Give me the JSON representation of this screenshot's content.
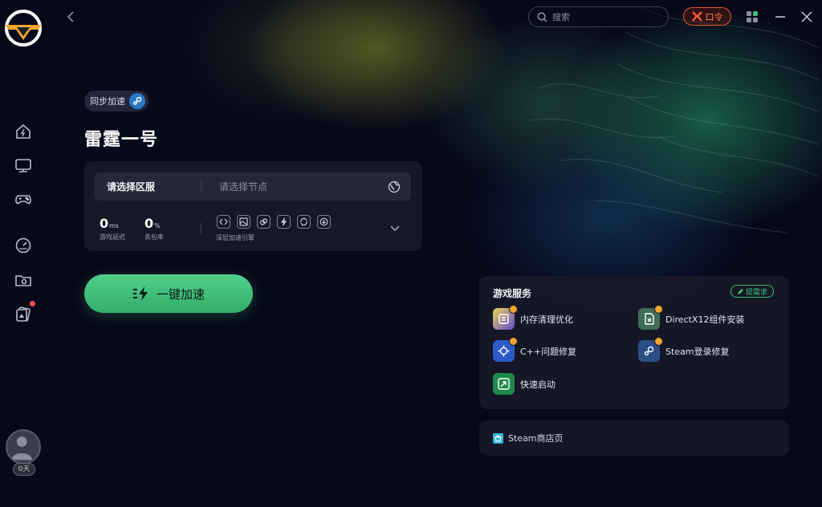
{
  "app": {
    "search_placeholder": "搜索",
    "kouling_label": "口令"
  },
  "sidebar": {
    "items": [
      {
        "name": "home",
        "icon": "home-icon"
      },
      {
        "name": "monitor",
        "icon": "monitor-icon"
      },
      {
        "name": "games",
        "icon": "gamepad-icon"
      },
      {
        "name": "speedometer",
        "icon": "speedometer-icon"
      },
      {
        "name": "folder",
        "icon": "folder-icon"
      },
      {
        "name": "cards",
        "icon": "cards-icon"
      }
    ],
    "user_badge": "0天"
  },
  "main": {
    "sync_label": "同步加速",
    "game_title": "雷霆一号",
    "server": {
      "region_label": "请选择区服",
      "node_placeholder": "请选择节点"
    },
    "stats": {
      "latency_value": "0",
      "latency_unit": "ms",
      "latency_label": "游戏延迟",
      "loss_value": "0",
      "loss_unit": "%",
      "loss_label": "丢包率"
    },
    "engine_label": "深层加速引擎",
    "accelerate_label": "一键加速"
  },
  "services": {
    "title": "游戏服务",
    "request_label": "提需求",
    "items": [
      {
        "label": "内存清理优化",
        "color": "#5b4ac9"
      },
      {
        "label": "DirectX12组件安装",
        "color": "#2f7a56"
      },
      {
        "label": "C++问题修复",
        "color": "#2b5bc8"
      },
      {
        "label": "Steam登录修复",
        "color": "#2a4f86"
      },
      {
        "label": "快速启动",
        "color": "#1f8a4a"
      }
    ]
  },
  "store": {
    "label": "Steam商店页"
  },
  "colors": {
    "accent_green": "#3bc078",
    "kouling_orange": "#e2572a"
  }
}
